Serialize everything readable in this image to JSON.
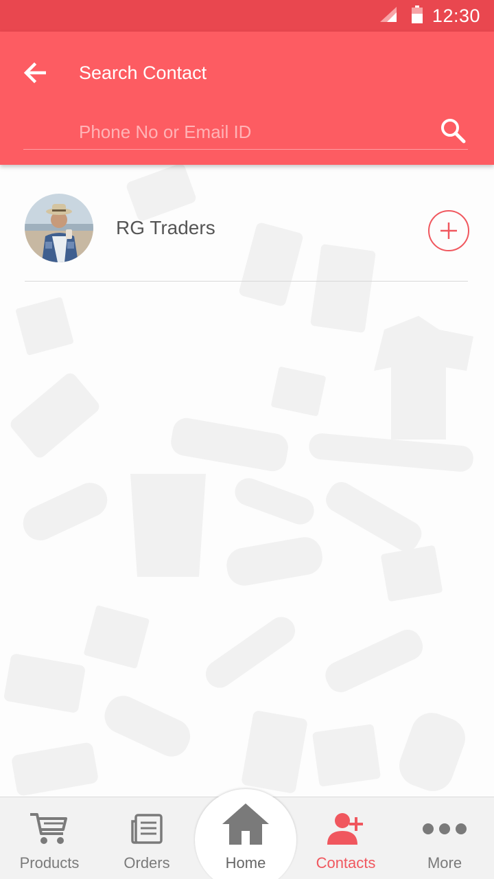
{
  "status_bar": {
    "time": "12:30",
    "signal_icon": "signal-icon",
    "battery_icon": "battery-icon",
    "background": "#e9474f"
  },
  "header": {
    "title": "Search Contact",
    "back_icon": "arrow-left-icon",
    "search": {
      "placeholder": "Phone No or Email ID",
      "value": "",
      "icon": "search-icon"
    },
    "background": "#fd5c62"
  },
  "contacts": [
    {
      "name": "RG Traders",
      "avatar_icon": "avatar",
      "action_icon": "plus-circle-icon"
    }
  ],
  "bottom_nav": {
    "items": [
      {
        "label": "Products",
        "icon": "cart-icon",
        "active": false
      },
      {
        "label": "Orders",
        "icon": "orders-list-icon",
        "active": false
      },
      {
        "label": "Home",
        "icon": "home-icon",
        "active": false
      },
      {
        "label": "Contacts",
        "icon": "add-contact-icon",
        "active": true
      },
      {
        "label": "More",
        "icon": "more-dots-icon",
        "active": false
      }
    ],
    "active_color": "#f0575e",
    "inactive_color": "#7a7a7a"
  }
}
